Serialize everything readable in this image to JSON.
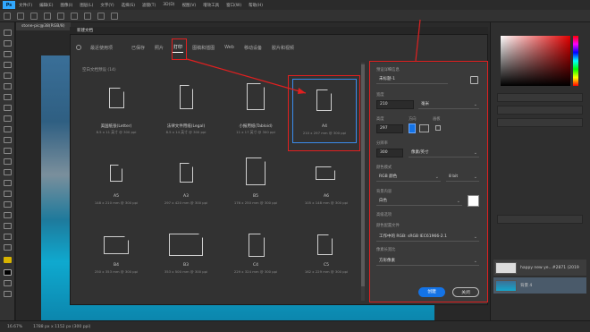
{
  "app": {
    "logo": "Ps"
  },
  "menus": [
    "文件(F)",
    "编辑(E)",
    "图像(I)",
    "图层(L)",
    "文字(Y)",
    "选择(S)",
    "滤镜(T)",
    "3D(D)",
    "视图(V)",
    "增效工具",
    "窗口(W)",
    "帮助(H)"
  ],
  "doc_tab": "stone-pic@38(RGB/8)",
  "status": {
    "zoom": "16.67%",
    "info": "1788 px x 1152 px (300 ppi)"
  },
  "dialog": {
    "title": "新建文档",
    "tabs": [
      {
        "label": "最近使用项",
        "icon": "clock-icon"
      },
      {
        "label": "已保存"
      },
      {
        "label": "照片"
      },
      {
        "label": "打印"
      },
      {
        "label": "图稿和插图"
      },
      {
        "label": "Web"
      },
      {
        "label": "移动设备"
      },
      {
        "label": "胶片和视频"
      }
    ],
    "active_tab": "打印",
    "grid_title": "空白文档预设 (14)",
    "items": [
      {
        "name": "美国纸张(Letter)",
        "sub": "8.5 x 11 英寸 @ 300 ppi"
      },
      {
        "name": "法律文件用纸(Legal)",
        "sub": "8.5 x 14 英寸 @ 300 ppi"
      },
      {
        "name": "小报用纸(Tabloid)",
        "sub": "11 x 17 英寸 @ 300 ppi"
      },
      {
        "name": "A4",
        "sub": "210 x 297 mm @ 300 ppi"
      },
      {
        "name": "A5",
        "sub": "148 x 210 mm @ 300 ppi"
      },
      {
        "name": "A3",
        "sub": "297 x 420 mm @ 300 ppi"
      },
      {
        "name": "B5",
        "sub": "176 x 250 mm @ 300 ppi"
      },
      {
        "name": "A6",
        "sub": "105 x 148 mm @ 300 ppi"
      },
      {
        "name": "B4",
        "sub": "250 x 353 mm @ 300 ppi"
      },
      {
        "name": "B3",
        "sub": "353 x 500 mm @ 300 ppi"
      },
      {
        "name": "C4",
        "sub": "229 x 324 mm @ 300 ppi"
      },
      {
        "name": "C5",
        "sub": "162 x 229 mm @ 300 ppi"
      }
    ],
    "details": {
      "header": "预设详细信息",
      "doc_name": "未标题-1",
      "width_label": "宽度",
      "width_value": "210",
      "width_unit": "毫米",
      "height_label": "高度",
      "height_value": "297",
      "orient_label": "方向",
      "artboard_label": "画板",
      "res_label": "分辨率",
      "res_value": "300",
      "res_unit": "像素/英寸",
      "color_mode_label": "颜色模式",
      "color_mode_value": "RGB 颜色",
      "bit_value": "8 bit",
      "bg_label": "背景内容",
      "bg_value": "白色",
      "advanced_label": "高级选项",
      "profile_label": "颜色配置文件",
      "profile_value": "工作中的 RGB: sRGB IEC61966-2.1",
      "pixel_label": "像素长宽比",
      "pixel_value": "方形像素",
      "create_label": "创建",
      "close_label": "关闭"
    }
  },
  "layers": [
    {
      "name": "happy new ye...#2871 (2019"
    },
    {
      "name": "背景 4"
    }
  ],
  "accent": "#1473e6",
  "annotation_color": "#e02020"
}
